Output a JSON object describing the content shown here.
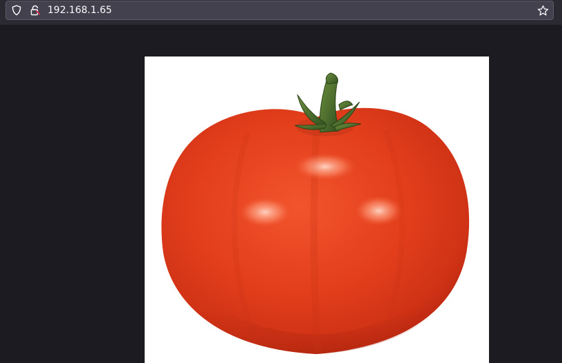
{
  "browser": {
    "url": "192.168.1.65",
    "icons": {
      "tracking_protection": "shield-icon",
      "connection": "lock-warning-icon",
      "bookmark": "star-icon"
    },
    "colors": {
      "toolbar": "#2b2a33",
      "urlbar": "#42414d",
      "page_background": "#1c1b22",
      "warning_accent": "#e22850"
    }
  },
  "page": {
    "image": {
      "subject": "tomato",
      "colors": {
        "tomato": "#e0401e",
        "stem": "#3f6b2a",
        "background": "#ffffff"
      }
    }
  }
}
